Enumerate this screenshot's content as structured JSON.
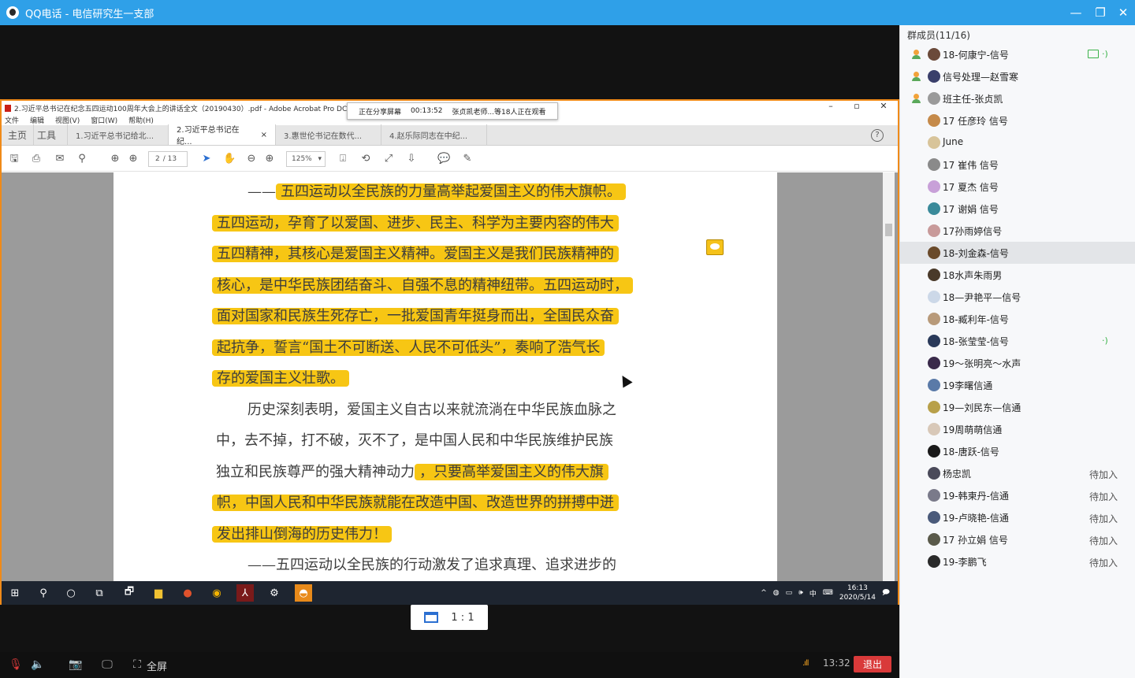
{
  "window": {
    "title": "QQ电话 - 电信研究生一支部",
    "min": "—",
    "restore": "❐",
    "close": "✕"
  },
  "share_tip": {
    "status": "正在分享屏幕",
    "time": "00:13:52",
    "viewers": "张贞凯老师...等18人正在观看"
  },
  "acrobat": {
    "title": "2.习近平总书记在纪念五四运动100周年大会上的讲话全文（20190430）.pdf - Adobe Acrobat Pro DC",
    "menu": [
      "文件",
      "编辑",
      "视图(V)",
      "窗口(W)",
      "帮助(H)"
    ],
    "tabs": [
      {
        "label": "主页",
        "active": false
      },
      {
        "label": "工具",
        "active": false
      },
      {
        "label": "1.习近平总书记给北...",
        "active": false
      },
      {
        "label": "2.习近平总书记在纪...",
        "active": true
      },
      {
        "label": "3.惠世伦书记在数代...",
        "active": false
      },
      {
        "label": "4.赵乐际同志在中纪...",
        "active": false
      }
    ],
    "close_tab": "×",
    "help": "?",
    "page_current": "2",
    "page_total": "/ 13",
    "zoom": "125%"
  },
  "doc_lines": [
    {
      "plain": "——",
      "hl": "五四运动以全民族的力量高举起爱国主义的伟大旗帜。",
      "after": ""
    },
    {
      "plain": "",
      "hl": "五四运动，孕育了以爱国、进步、民主、科学为主要内容的伟大",
      "after": ""
    },
    {
      "plain": "",
      "hl": "五四精神，其核心是爱国主义精神。爱国主义是我们民族精神的",
      "after": ""
    },
    {
      "plain": "",
      "hl": "核心，是中华民族团结奋斗、自强不息的精神纽带。五四运动时，",
      "after": ""
    },
    {
      "plain": "",
      "hl": "面对国家和民族生死存亡，一批爱国青年挺身而出，全国民众奋",
      "after": ""
    },
    {
      "plain": "",
      "hl": "起抗争，誓言“国土不可断送、人民不可低头”，奏响了浩气长",
      "after": ""
    },
    {
      "plain": "",
      "hl": "存的爱国主义壮歌。",
      "after": ""
    },
    {
      "plain": "历史深刻表明，爱国主义自古以来就流淌在中华民族血脉之",
      "hl": "",
      "after": ""
    },
    {
      "plain": "中，去不掉，打不破，灭不了，是中国人民和中华民族维护民族",
      "hl": "",
      "after": ""
    },
    {
      "plain": "独立和民族尊严的强大精神动力",
      "hl": "，只要高举爱国主义的伟大旗",
      "after": ""
    },
    {
      "plain": "",
      "hl": "帜，中国人民和中华民族就能在改造中国、改造世界的拼搏中迸",
      "after": ""
    },
    {
      "plain": "",
      "hl": "发出排山倒海的历史伟力！",
      "after": ""
    },
    {
      "plain": "——五四运动以全民族的行动激发了追求真理、追求进步的",
      "hl": "",
      "after": ""
    }
  ],
  "taskbar": {
    "clock_time": "16:13",
    "clock_date": "2020/5/14",
    "ime": "中"
  },
  "ratio": {
    "label": "1 : 1"
  },
  "controls": {
    "fullscreen": "全屏",
    "time": "13:32",
    "exit": "退出"
  },
  "members": {
    "header": "群成员(11/16)",
    "list": [
      {
        "name": "18-何康宁-信号",
        "role": true,
        "status": "",
        "speaking": true,
        "sharing": true,
        "color": "#6b4a3a"
      },
      {
        "name": "信号处理—赵雪寒",
        "role": true,
        "status": "",
        "speaking": false,
        "sharing": false,
        "color": "#3a3f6b"
      },
      {
        "name": "班主任-张贞凯",
        "role": true,
        "status": "",
        "speaking": false,
        "sharing": false,
        "color": "#9a9a9a"
      },
      {
        "name": "17 任彦玲 信号",
        "role": false,
        "status": "",
        "speaking": false,
        "sharing": false,
        "color": "#c58a4a"
      },
      {
        "name": "June",
        "role": false,
        "status": "",
        "speaking": false,
        "sharing": false,
        "color": "#d8c49a"
      },
      {
        "name": "17 崔伟 信号",
        "role": false,
        "status": "",
        "speaking": false,
        "sharing": false,
        "color": "#8a8a8a"
      },
      {
        "name": "17 夏杰 信号",
        "role": false,
        "status": "",
        "speaking": false,
        "sharing": false,
        "color": "#c8a0d8"
      },
      {
        "name": "17 谢娟 信号",
        "role": false,
        "status": "",
        "speaking": false,
        "sharing": false,
        "color": "#3a8a9a"
      },
      {
        "name": "17孙雨婷信号",
        "role": false,
        "status": "",
        "speaking": false,
        "sharing": false,
        "color": "#c89a9a"
      },
      {
        "name": "18-刘金森-信号",
        "role": false,
        "status": "",
        "speaking": false,
        "sharing": false,
        "color": "#6a4a2a",
        "selected": true
      },
      {
        "name": "18水声朱雨男",
        "role": false,
        "status": "",
        "speaking": false,
        "sharing": false,
        "color": "#4a3a2a"
      },
      {
        "name": "18—尹艳平—信号",
        "role": false,
        "status": "",
        "speaking": false,
        "sharing": false,
        "color": "#ccd8e8"
      },
      {
        "name": "18-臧利年-信号",
        "role": false,
        "status": "",
        "speaking": false,
        "sharing": false,
        "color": "#b89a7a"
      },
      {
        "name": "18-张莹莹-信号",
        "role": false,
        "status": "",
        "speaking": true,
        "sharing": false,
        "color": "#2a3a5a"
      },
      {
        "name": "19～张明亮～水声",
        "role": false,
        "status": "",
        "speaking": false,
        "sharing": false,
        "color": "#3a2a4a"
      },
      {
        "name": "19李曙信通",
        "role": false,
        "status": "",
        "speaking": false,
        "sharing": false,
        "color": "#5a7aa8"
      },
      {
        "name": "19—刘民东—信通",
        "role": false,
        "status": "",
        "speaking": false,
        "sharing": false,
        "color": "#b8a04a"
      },
      {
        "name": "19周萌萌信通",
        "role": false,
        "status": "",
        "speaking": false,
        "sharing": false,
        "color": "#d8c8b8"
      },
      {
        "name": "18-唐跃-信号",
        "role": false,
        "status": "",
        "speaking": false,
        "sharing": false,
        "color": "#1a1a1a"
      },
      {
        "name": "杨忠凯",
        "role": false,
        "status": "待加入",
        "speaking": false,
        "sharing": false,
        "color": "#4a4a5a"
      },
      {
        "name": "19-韩柬丹-信通",
        "role": false,
        "status": "待加入",
        "speaking": false,
        "sharing": false,
        "color": "#7a7a8a"
      },
      {
        "name": "19-卢晓艳-信通",
        "role": false,
        "status": "待加入",
        "speaking": false,
        "sharing": false,
        "color": "#4a5a7a"
      },
      {
        "name": "17 孙立娟 信号",
        "role": false,
        "status": "待加入",
        "speaking": false,
        "sharing": false,
        "color": "#5a5a4a"
      },
      {
        "name": "19-李鹏飞",
        "role": false,
        "status": "待加入",
        "speaking": false,
        "sharing": false,
        "color": "#2a2a2a"
      }
    ]
  },
  "colors": {
    "titlebar": "#2fa0e8",
    "highlight": "#f7c614",
    "share_border": "#f08a18",
    "exit": "#d93a3a"
  }
}
